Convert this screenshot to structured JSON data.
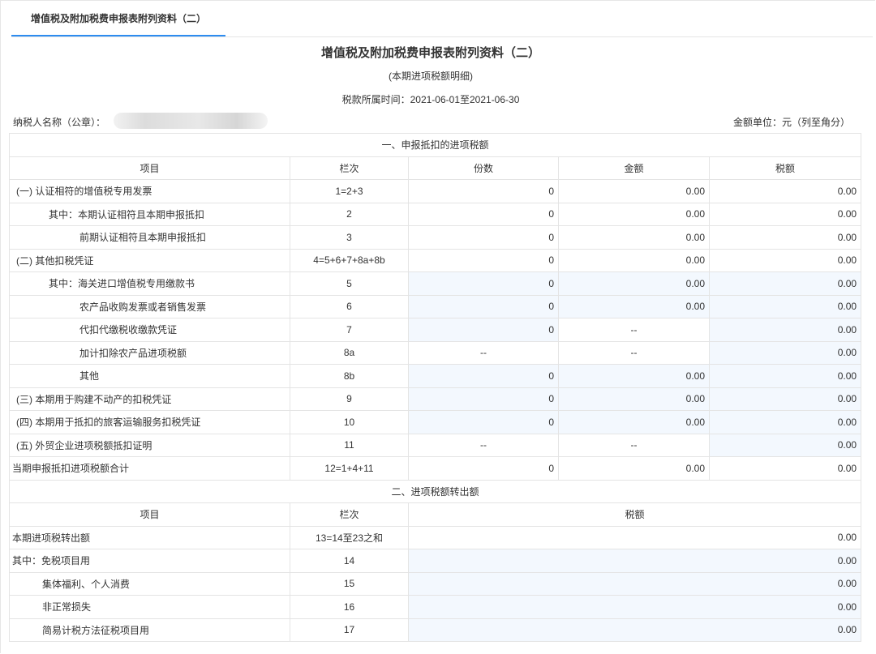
{
  "tab": {
    "label": "增值税及附加税费申报表附列资料（二）"
  },
  "form": {
    "title": "增值税及附加税费申报表附列资料（二）",
    "subtitle": "(本期进项税额明细)",
    "period_label": "税款所属时间：2021-06-01至2021-06-30",
    "taxpayer_label": "纳税人名称（公章）：",
    "unit_label": "金额单位：元（列至角分）"
  },
  "section1": {
    "title": "一、申报抵扣的进项税额",
    "headers": [
      "项目",
      "栏次",
      "份数",
      "金额",
      "税额"
    ],
    "rows": [
      {
        "item": "(一) 认证相符的增值税专用发票",
        "line": "1=2+3",
        "count": "0",
        "amount": "0.00",
        "tax": "0.00"
      },
      {
        "item": "其中：本期认证相符且本期申报抵扣",
        "line": "2",
        "count": "0",
        "amount": "0.00",
        "tax": "0.00"
      },
      {
        "item": "前期认证相符且本期申报抵扣",
        "line": "3",
        "count": "0",
        "amount": "0.00",
        "tax": "0.00"
      },
      {
        "item": "(二) 其他扣税凭证",
        "line": "4=5+6+7+8a+8b",
        "count": "0",
        "amount": "0.00",
        "tax": "0.00"
      },
      {
        "item": "其中：海关进口增值税专用缴款书",
        "line": "5",
        "count": "0",
        "amount": "0.00",
        "tax": "0.00"
      },
      {
        "item": "农产品收购发票或者销售发票",
        "line": "6",
        "count": "0",
        "amount": "0.00",
        "tax": "0.00"
      },
      {
        "item": "代扣代缴税收缴款凭证",
        "line": "7",
        "count": "0",
        "amount": "--",
        "tax": "0.00"
      },
      {
        "item": "加计扣除农产品进项税额",
        "line": "8a",
        "count": "--",
        "amount": "--",
        "tax": "0.00"
      },
      {
        "item": "其他",
        "line": "8b",
        "count": "0",
        "amount": "0.00",
        "tax": "0.00"
      },
      {
        "item": "(三) 本期用于购建不动产的扣税凭证",
        "line": "9",
        "count": "0",
        "amount": "0.00",
        "tax": "0.00"
      },
      {
        "item": "(四) 本期用于抵扣的旅客运输服务扣税凭证",
        "line": "10",
        "count": "0",
        "amount": "0.00",
        "tax": "0.00"
      },
      {
        "item": "(五) 外贸企业进项税额抵扣证明",
        "line": "11",
        "count": "--",
        "amount": "--",
        "tax": "0.00"
      },
      {
        "item": "当期申报抵扣进项税额合计",
        "line": "12=1+4+11",
        "count": "0",
        "amount": "0.00",
        "tax": "0.00"
      }
    ]
  },
  "section2": {
    "title": "二、进项税额转出额",
    "headers": [
      "项目",
      "栏次",
      "税额"
    ],
    "rows": [
      {
        "item": "本期进项税转出额",
        "line": "13=14至23之和",
        "tax": "0.00"
      },
      {
        "item": "其中：免税项目用",
        "line": "14",
        "tax": "0.00"
      },
      {
        "item": "集体福利、个人消费",
        "line": "15",
        "tax": "0.00"
      },
      {
        "item": "非正常损失",
        "line": "16",
        "tax": "0.00"
      },
      {
        "item": "简易计税方法征税项目用",
        "line": "17",
        "tax": "0.00"
      }
    ]
  },
  "colors": {
    "accent": "#2d8cf0",
    "input_bg": "#f3f8fe",
    "border": "#e4e4e4"
  }
}
